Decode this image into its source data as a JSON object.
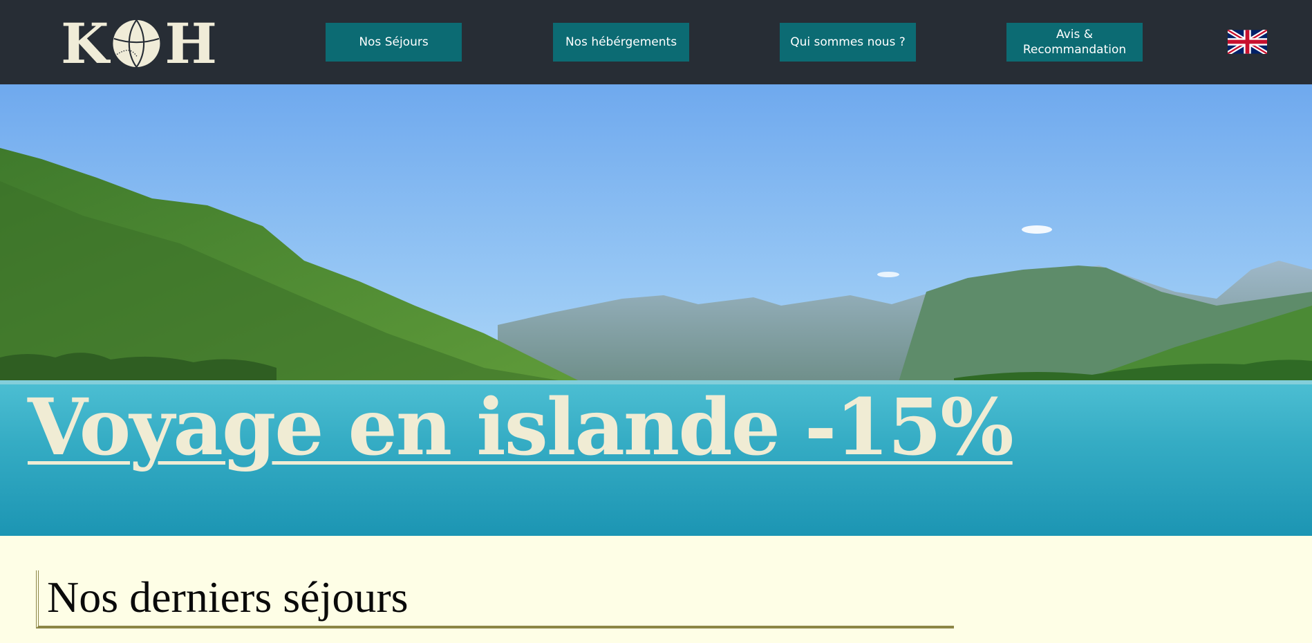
{
  "brand": {
    "logo_letter_left": "K",
    "logo_letter_right": "H",
    "logo_icon": "basketball-icon",
    "header_bg": "#272d35",
    "logo_color": "#f0ecd8"
  },
  "nav": {
    "button_color": "#0c6b73",
    "items": [
      {
        "label": "Nos Séjours"
      },
      {
        "label": "Nos hébérgements"
      },
      {
        "label": "Qui sommes nous ?"
      },
      {
        "label": "Avis & Recommandation"
      }
    ],
    "language_icon": "uk-flag-icon"
  },
  "hero": {
    "title": "Voyage en islande -15%",
    "title_color": "#f0ecd4"
  },
  "section": {
    "title": "Nos derniers séjours",
    "accent_color": "#8c8646"
  },
  "page": {
    "background": "#fefee6"
  }
}
